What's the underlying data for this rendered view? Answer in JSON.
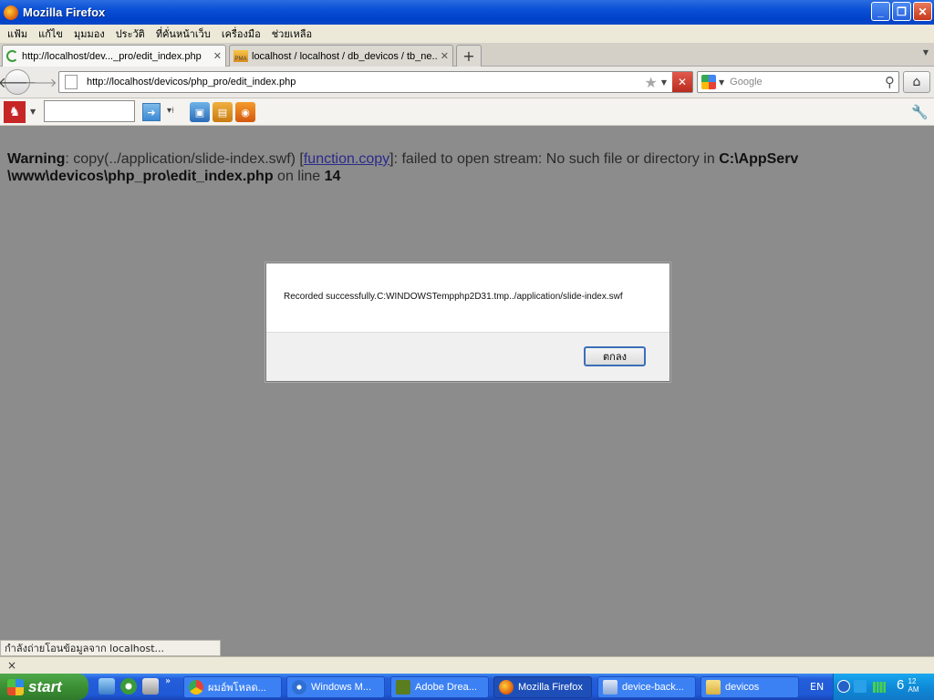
{
  "window": {
    "title": "Mozilla Firefox"
  },
  "menubar": {
    "items": [
      "แฟ้ม",
      "แก้ไข",
      "มุมมอง",
      "ประวัติ",
      "ที่คั่นหน้าเว็บ",
      "เครื่องมือ",
      "ช่วยเหลือ"
    ]
  },
  "tabs": [
    {
      "label": "http://localhost/dev..._pro/edit_index.php",
      "active": true
    },
    {
      "label": "localhost / localhost / db_devicos / tb_ne...",
      "active": false
    }
  ],
  "navbar": {
    "url": "http://localhost/devicos/php_pro/edit_index.php",
    "search_placeholder": "Google"
  },
  "content": {
    "warning_label": "Warning",
    "warning_text_1": ": copy(../application/slide-index.swf) [",
    "warning_link": "function.copy",
    "warning_text_2": "]: failed to open stream: No such file or directory in ",
    "warning_path": "C:\\AppServ \\www\\devicos\\php_pro\\edit_index.php",
    "warning_text_3": " on line ",
    "warning_line": "14"
  },
  "dialog": {
    "message": "Recorded successfully.C:WINDOWSTempphp2D31.tmp../application/slide-index.swf",
    "ok_label": "ตกลง"
  },
  "statusbar": {
    "text": "กำลังถ่ายโอนข้อมูลจาก localhost..."
  },
  "findbar": {
    "close": "×"
  },
  "taskbar": {
    "start_label": "start",
    "tasks": [
      {
        "label": "ผมอ์พโหลด...",
        "active": false
      },
      {
        "label": "Windows M...",
        "active": false
      },
      {
        "label": "Adobe Drea...",
        "active": false
      },
      {
        "label": "Mozilla Firefox",
        "active": true
      },
      {
        "label": "device-back...",
        "active": false
      },
      {
        "label": "devicos",
        "active": false
      }
    ],
    "lang": "EN",
    "clock": "6",
    "clock_min": "12",
    "clock_ampm": "AM"
  },
  "icons": {
    "firefox": "firefox-icon",
    "back": "back-arrow-icon",
    "forward": "forward-arrow-icon",
    "bookmark": "star-icon",
    "stop": "stop-icon",
    "search": "magnifier-icon",
    "home": "home-icon",
    "wrench": "wrench-icon"
  }
}
